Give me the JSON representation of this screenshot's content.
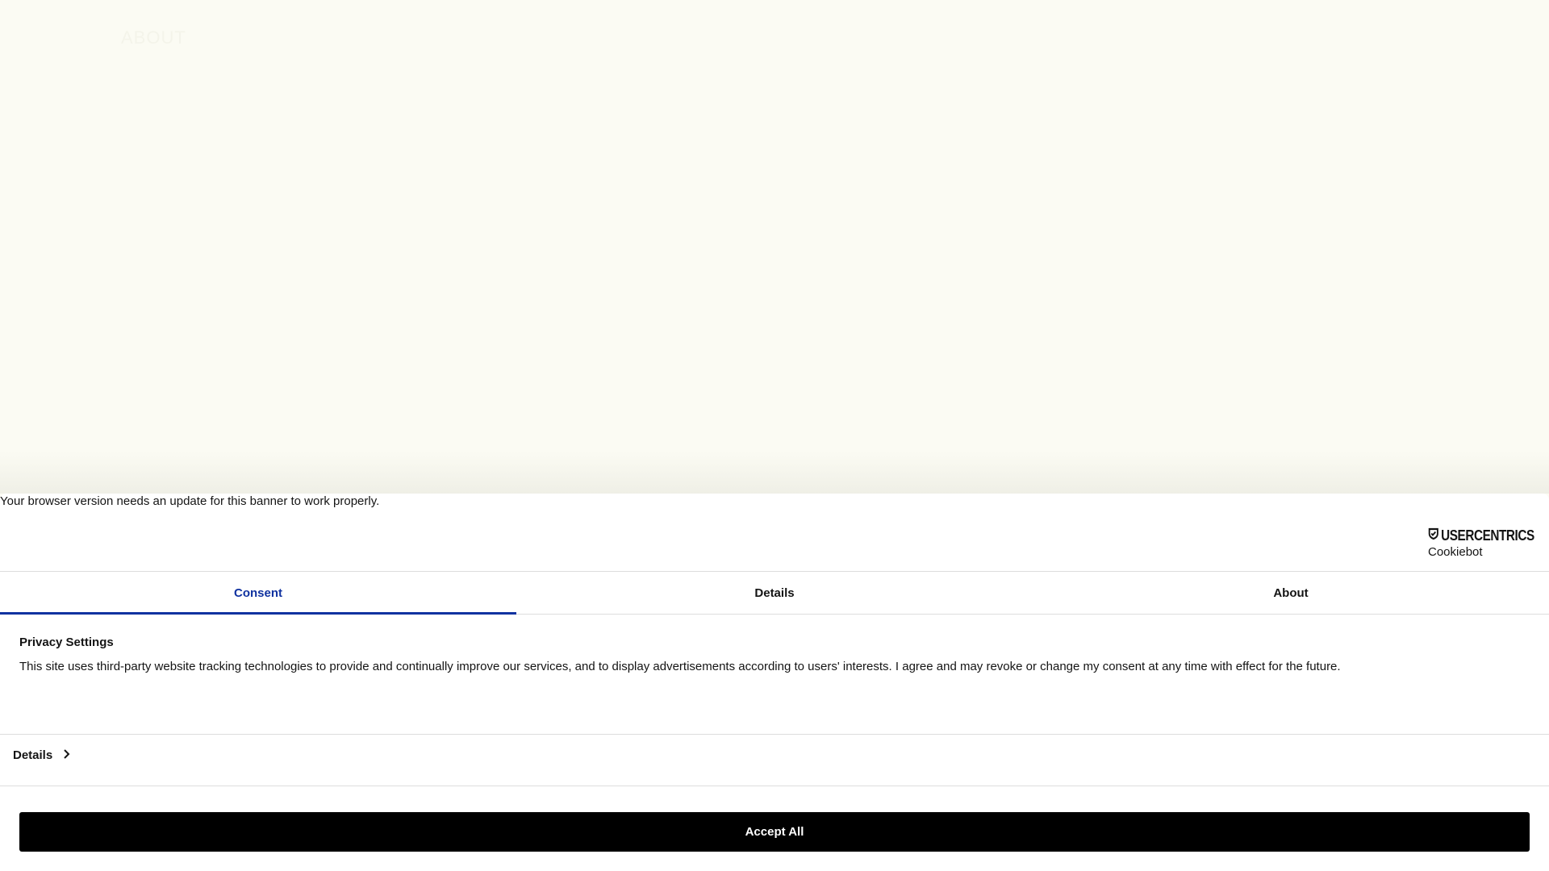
{
  "background": {
    "ghost_text": "ABOUT"
  },
  "banner": {
    "warning": "Your browser version needs an update for this banner to work properly.",
    "logo": {
      "brand": "USERCENTRICS",
      "product": "Cookiebot"
    },
    "tabs": [
      {
        "label": "Consent"
      },
      {
        "label": "Details"
      },
      {
        "label": "About"
      }
    ],
    "heading": "Privacy Settings",
    "body": "This site uses third-party website tracking technologies to provide and continually improve our services, and to display advertisements according to users' interests. I agree and may revoke or change my consent at any time with effect for the future.",
    "details_link": "Details",
    "accept_button": "Accept All"
  },
  "colors": {
    "accent": "#1032a0",
    "button": "#000000",
    "page_bg": "#fbfbf3"
  }
}
